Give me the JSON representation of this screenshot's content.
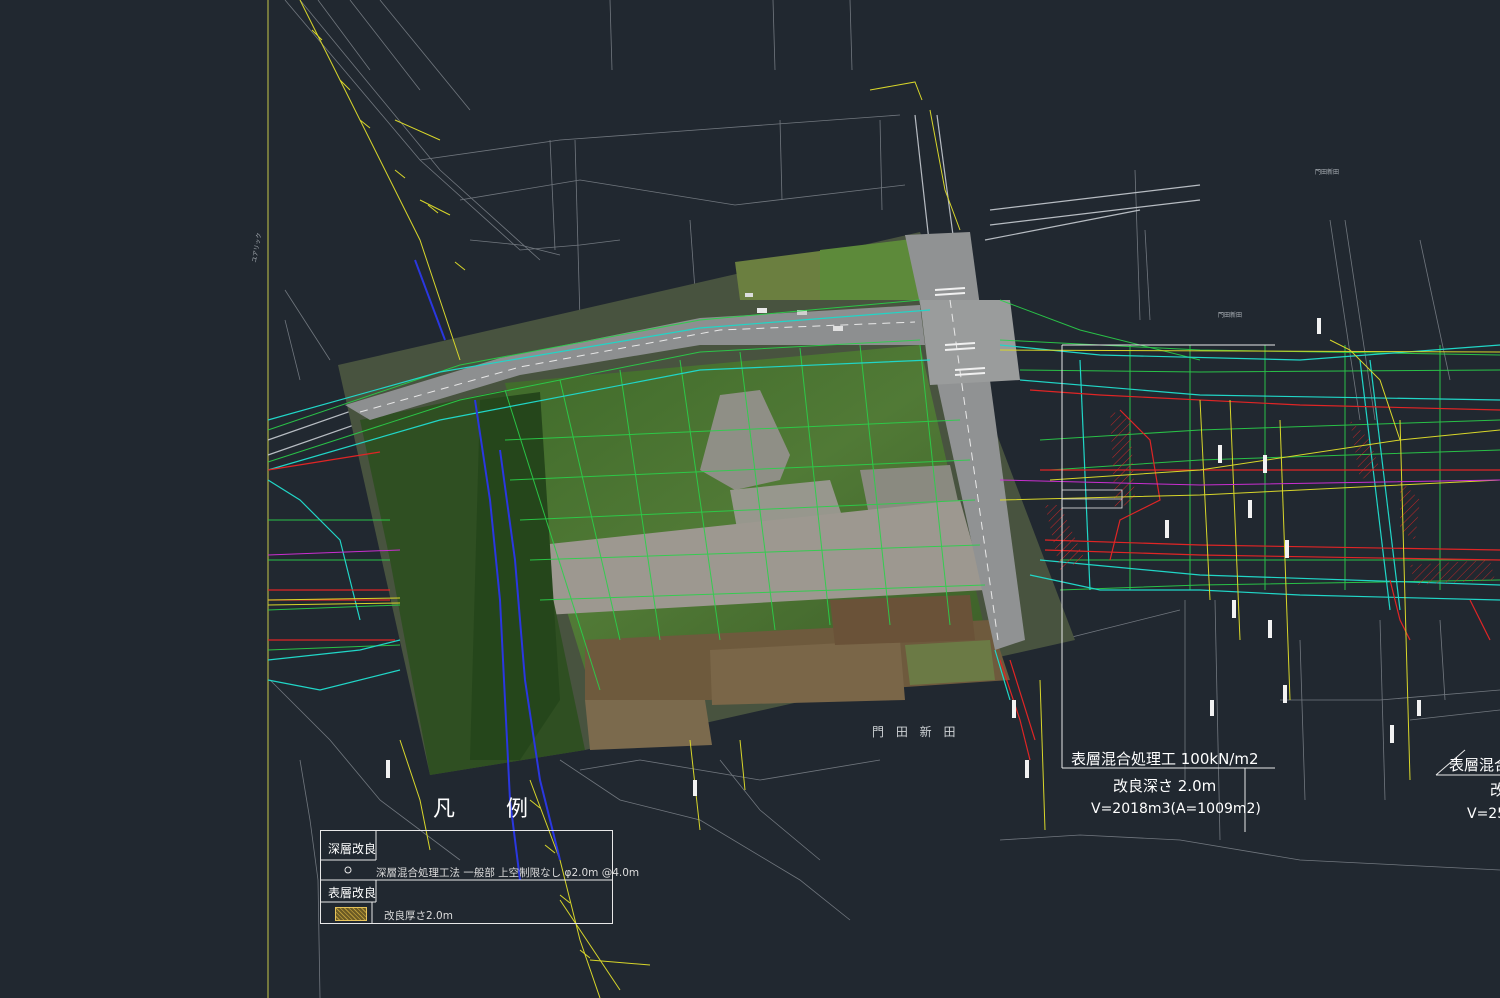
{
  "legend": {
    "title": "凡 例",
    "deep_label": "深層改良",
    "deep_desc": "深層混合処理工法 一般部 上空制限なし φ2.0m @4.0m",
    "surface_label": "表層改良",
    "surface_desc": "改良厚さ2.0m"
  },
  "annotation_main": {
    "line1": "表層混合処理工 100kN/m2",
    "line2": "改良深さ 2.0m",
    "line3": "V=2018m3(A=1009m2)"
  },
  "annotation_right": {
    "line1": "表層混合",
    "line2": "改",
    "line3": "V=25"
  },
  "map_labels": {
    "place_kadota": "門 田 新 田",
    "place_yuarikku": "ユアリック",
    "place_kadota_small": "門田新田",
    "place_kadota_small2": "門田新田"
  },
  "colors": {
    "background": "#212830",
    "green_line": "#2ad14a",
    "cyan_line": "#21d6c7",
    "red_line": "#e02525",
    "yellow_line": "#d8d62a",
    "blue_line": "#2a37e0",
    "grey_line": "#9aa0a6"
  }
}
